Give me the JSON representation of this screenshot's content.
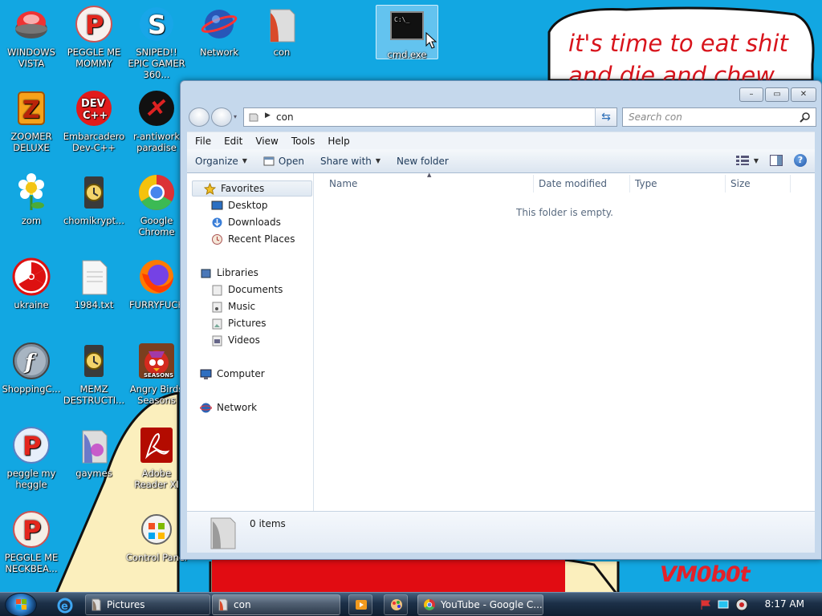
{
  "wallpaper": {
    "speech_line1": "it's time to eat shit",
    "speech_line2": "and die and chew",
    "signature": "VM0b0t"
  },
  "desktop_icons": [
    {
      "label": "WINDOWS VISTA",
      "icon": "windows-vista-icon"
    },
    {
      "label": "PEGGLE ME MOMMY",
      "icon": "peggle-icon"
    },
    {
      "label": "SNIPED!! EPIC GAMER 360...",
      "icon": "skype-icon"
    },
    {
      "label": "Network",
      "icon": "network-globe-icon"
    },
    {
      "label": "con",
      "icon": "folder-icon"
    },
    {
      "label": "cmd.exe",
      "icon": "command-prompt-icon"
    },
    {
      "label": "ZOOMER DELUXE",
      "icon": "zuma-icon"
    },
    {
      "label": "Embarcadero Dev-C++",
      "icon": "devcpp-icon"
    },
    {
      "label": "r-antiwork paradise",
      "icon": "antiwork-icon"
    },
    {
      "label": "zom",
      "icon": "plants-vs-zombies-icon"
    },
    {
      "label": "chomikrypt...",
      "icon": "hourglass-installer-icon"
    },
    {
      "label": "Google Chrome",
      "icon": "chrome-icon"
    },
    {
      "label": "ukraine",
      "icon": "radiation-icon"
    },
    {
      "label": "1984.txt",
      "icon": "text-file-icon"
    },
    {
      "label": "FURRYFUCK",
      "icon": "firefox-icon"
    },
    {
      "label": "ShoppingC...",
      "icon": "flash-icon"
    },
    {
      "label": "MEMZ DESTRUCTI...",
      "icon": "hourglass-installer-icon"
    },
    {
      "label": "Angry Birds Seasons",
      "icon": "angry-birds-icon"
    },
    {
      "label": "peggle my heggle",
      "icon": "peggle-icon"
    },
    {
      "label": "gaymes",
      "icon": "games-folder-icon"
    },
    {
      "label": "Adobe Reader XI",
      "icon": "adobe-reader-icon"
    },
    {
      "label": "PEGGLE ME NECKBEA...",
      "icon": "peggle-icon"
    },
    {
      "label": "Control Panel",
      "icon": "control-panel-icon"
    }
  ],
  "explorer": {
    "controls": {
      "minimize": "–",
      "maximize": "▭",
      "close": "✕"
    },
    "address_path": "con",
    "search_placeholder": "Search con",
    "menu": [
      "File",
      "Edit",
      "View",
      "Tools",
      "Help"
    ],
    "toolbar": {
      "organize": "Organize",
      "open": "Open",
      "share_with": "Share with",
      "new_folder": "New folder"
    },
    "nav": {
      "favorites": "Favorites",
      "desktop": "Desktop",
      "downloads": "Downloads",
      "recent_places": "Recent Places",
      "libraries": "Libraries",
      "documents": "Documents",
      "music": "Music",
      "pictures": "Pictures",
      "videos": "Videos",
      "computer": "Computer",
      "network": "Network"
    },
    "columns": [
      "Name",
      "Date modified",
      "Type",
      "Size"
    ],
    "empty_message": "This folder is empty.",
    "item_count": "0 items"
  },
  "taskbar": {
    "tasks": [
      {
        "label": "Pictures",
        "icon": "folder-icon"
      },
      {
        "label": "con",
        "icon": "folder-icon"
      },
      {
        "label": "YouTube - Google C...",
        "icon": "chrome-icon"
      }
    ],
    "clock": "8:17 AM"
  },
  "colors": {
    "desktop_bg": "#12a7e2",
    "meme_text": "#d8141c",
    "explorer_frame": "#c5d8ec",
    "taskbar": "#1c3048"
  }
}
